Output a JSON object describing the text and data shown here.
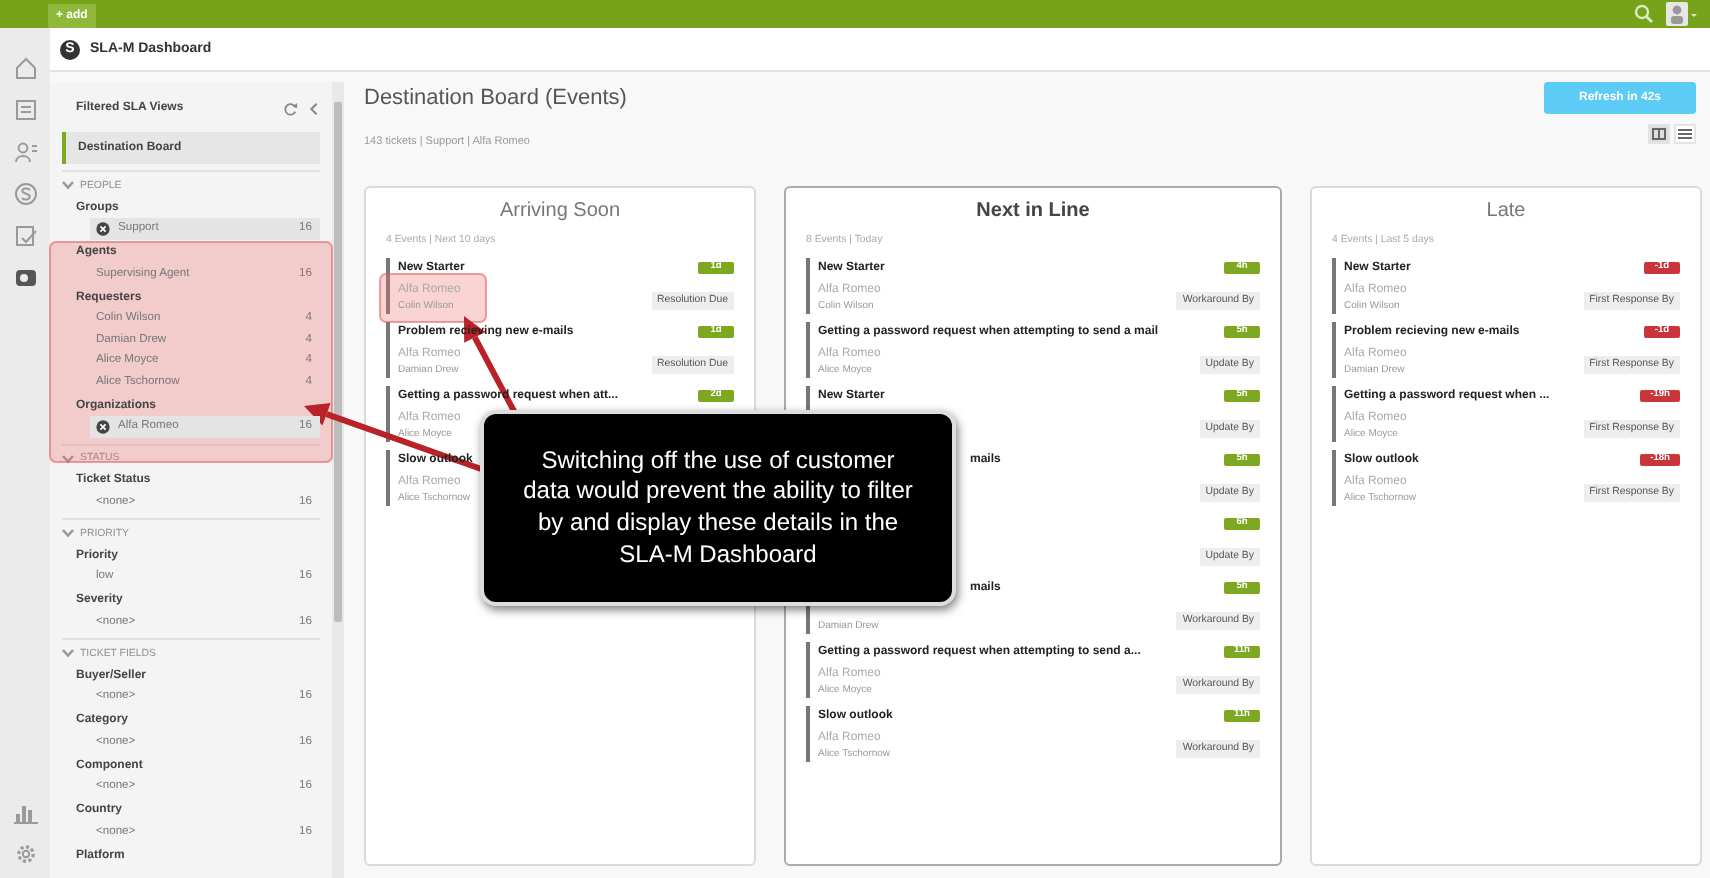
{
  "top_bar": {
    "add_button": "+ add"
  },
  "header": {
    "logo": "S",
    "title": "SLA-M Dashboard"
  },
  "sidebar": {
    "title": "Filtered SLA Views",
    "views": [
      {
        "label": "Destination Board",
        "selected": true
      }
    ],
    "sections": [
      {
        "heading": "PEOPLE",
        "expanded": true,
        "fields": [
          {
            "label": "Groups",
            "values": [
              {
                "label": "Support",
                "count": "16",
                "active": true
              }
            ]
          },
          {
            "label": "Agents",
            "values": [
              {
                "label": "Supervising Agent",
                "count": "16",
                "active": false
              }
            ]
          },
          {
            "label": "Requesters",
            "values": [
              {
                "label": "Colin Wilson",
                "count": "4",
                "active": false
              },
              {
                "label": "Damian Drew",
                "count": "4",
                "active": false
              },
              {
                "label": "Alice Moyce",
                "count": "4",
                "active": false
              },
              {
                "label": "Alice Tschornow",
                "count": "4",
                "active": false
              }
            ]
          },
          {
            "label": "Organizations",
            "values": [
              {
                "label": "Alfa Romeo",
                "count": "16",
                "active": true
              }
            ]
          }
        ]
      },
      {
        "heading": "STATUS",
        "expanded": true,
        "fields": [
          {
            "label": "Ticket Status",
            "values": [
              {
                "label": "<none>",
                "count": "16",
                "active": false
              }
            ]
          }
        ]
      },
      {
        "heading": "PRIORITY",
        "expanded": true,
        "fields": [
          {
            "label": "Priority",
            "values": [
              {
                "label": "low",
                "count": "16",
                "active": false
              }
            ]
          },
          {
            "label": "Severity",
            "values": [
              {
                "label": "<none>",
                "count": "16",
                "active": false
              }
            ]
          }
        ]
      },
      {
        "heading": "TICKET FIELDS",
        "expanded": true,
        "fields": [
          {
            "label": "Buyer/Seller",
            "values": [
              {
                "label": "<none>",
                "count": "16",
                "active": false
              }
            ]
          },
          {
            "label": "Category",
            "values": [
              {
                "label": "<none>",
                "count": "16",
                "active": false
              }
            ]
          },
          {
            "label": "Component",
            "values": [
              {
                "label": "<none>",
                "count": "16",
                "active": false
              }
            ]
          },
          {
            "label": "Country",
            "values": [
              {
                "label": "<none>",
                "count": "16",
                "active": false
              }
            ]
          },
          {
            "label": "Platform"
          }
        ]
      }
    ]
  },
  "main": {
    "title": "Destination Board (Events)",
    "summary": "143 tickets | Support | Alfa Romeo",
    "refresh_button": "Refresh in 42s",
    "view_modes": [
      {
        "kind": "board",
        "selected": true
      },
      {
        "kind": "list",
        "selected": false
      }
    ],
    "columns": [
      {
        "title": "Arriving Soon",
        "meta": "4 Events | Next 10 days",
        "items": [
          {
            "title": "New Starter",
            "company": "Alfa Romeo",
            "person": "Colin Wilson",
            "due": "1d",
            "color": "#7ea821",
            "tag": "Resolution Due"
          },
          {
            "title": "Problem recieving new e-mails",
            "company": "Alfa Romeo",
            "person": "Damian Drew",
            "due": "1d",
            "color": "#7ea821",
            "tag": "Resolution Due"
          },
          {
            "title": "Getting a password request when att...",
            "company": "Alfa Romeo",
            "person": "Alice Moyce",
            "due": "2d",
            "color": "#7ea821"
          },
          {
            "title": "Slow outlook",
            "company": "Alfa Romeo",
            "person": "Alice Tschornow"
          }
        ]
      },
      {
        "title": "Next in Line",
        "meta": "8 Events | Today",
        "items": [
          {
            "title": "New Starter",
            "company": "Alfa Romeo",
            "person": "Colin Wilson",
            "due": "4h",
            "color": "#7ea821",
            "tag": "Workaround By"
          },
          {
            "title": "Getting a password request when attempting to send a mail",
            "company": "Alfa Romeo",
            "person": "Alice Moyce",
            "due": "5h",
            "color": "#7ea821",
            "tag": "Update By"
          },
          {
            "title": "New Starter",
            "due": "5h",
            "color": "#7ea821",
            "tag": "Update By"
          },
          {
            "title": "mails",
            "title_covered": true,
            "due": "5h",
            "color": "#7ea821",
            "tag": "Update By"
          },
          {
            "due": "6h",
            "color": "#7ea821",
            "tag": "Update By"
          },
          {
            "title": "mails",
            "title_covered": true,
            "person": "Damian Drew",
            "due": "5h",
            "color": "#7ea821",
            "tag": "Workaround By"
          },
          {
            "title": "Getting a password request when attempting to send a...",
            "company": "Alfa Romeo",
            "person": "Alice Moyce",
            "due": "11h",
            "color": "#7ea821",
            "tag": "Workaround By"
          },
          {
            "title": "Slow outlook",
            "company": "Alfa Romeo",
            "person": "Alice Tschornow",
            "due": "11h",
            "color": "#7ea821",
            "tag": "Workaround By"
          }
        ]
      },
      {
        "title": "Late",
        "meta": "4 Events | Last 5 days",
        "items": [
          {
            "title": "New Starter",
            "company": "Alfa Romeo",
            "person": "Colin Wilson",
            "due": "-1d",
            "color": "#c9353a",
            "tag": "First Response By"
          },
          {
            "title": "Problem recieving new e-mails",
            "company": "Alfa Romeo",
            "person": "Damian Drew",
            "due": "-1d",
            "color": "#c9353a",
            "tag": "First Response By"
          },
          {
            "title": "Getting a password request when ...",
            "company": "Alfa Romeo",
            "person": "Alice Moyce",
            "due": "-19h",
            "color": "#c9353a",
            "tag": "First Response By"
          },
          {
            "title": "Slow outlook",
            "company": "Alfa Romeo",
            "person": "Alice Tschornow",
            "due": "-18h",
            "color": "#c9353a",
            "tag": "First Response By"
          }
        ]
      }
    ]
  },
  "callout": {
    "text": "Switching off the use of customer data would prevent the ability to filter by and display these details in the SLA-M Dashboard"
  }
}
